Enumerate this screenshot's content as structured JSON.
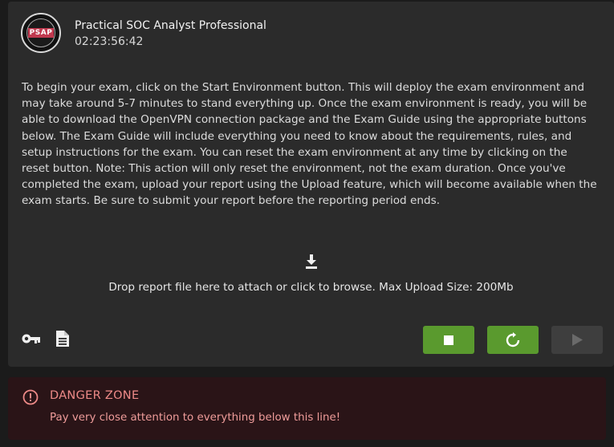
{
  "exam": {
    "badge_text": "PSAP",
    "title": "Practical SOC Analyst Professional",
    "timer": "02:23:56:42",
    "instructions": "To begin your exam, click on the Start Environment button. This will deploy the exam environment and may take around 5-7 minutes to stand everything up. Once the exam environment is ready, you will be able to download the OpenVPN connection package and the Exam Guide using the appropriate buttons below. The Exam Guide will include everything you need to know about the requirements, rules, and setup instructions for the exam. You can reset the exam environment at any time by clicking on the reset button. Note: This action will only reset the environment, not the exam duration. Once you've completed the exam, upload your report using the Upload feature, which will become available when the exam starts. Be sure to submit your report before the reporting period ends."
  },
  "upload": {
    "label": "Drop report file here to attach or click to browse. Max Upload Size: 200Mb"
  },
  "icons": {
    "vpn": "key-icon",
    "guide": "document-icon",
    "stop": "stop-icon",
    "reset": "refresh-icon",
    "start": "play-icon",
    "upload": "download-arrow-icon",
    "danger": "alert-circle-icon"
  },
  "colors": {
    "accent_green": "#5a9a2e",
    "danger_text": "#ee8a88",
    "danger_bg": "#2a1417"
  },
  "danger_zone": {
    "title": "DANGER ZONE",
    "message": "Pay very close attention to everything below this line!"
  }
}
